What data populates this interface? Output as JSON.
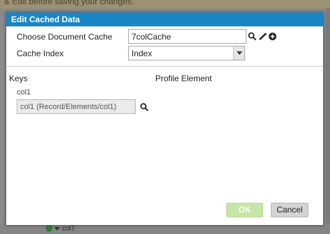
{
  "background": {
    "banner_text": "& Edit before saving your changes.",
    "tree_item_label": "col7"
  },
  "dialog": {
    "title": "Edit Cached Data",
    "document_cache": {
      "label": "Choose Document Cache",
      "value": "7colCache",
      "icons": [
        "search-icon",
        "edit-icon",
        "add-icon"
      ]
    },
    "cache_index": {
      "label": "Cache Index",
      "selected": "Index"
    },
    "keys_heading": "Keys",
    "profile_element_heading": "Profile Element",
    "key": {
      "name": "col1",
      "value": "col1 (Record/Elements/col1)"
    },
    "buttons": {
      "ok": "OK",
      "cancel": "Cancel"
    }
  },
  "colors": {
    "titlebar": "#1a86c6",
    "ok_button_disabled": "#c5e6a6",
    "cancel_button": "#d4d4d4"
  }
}
